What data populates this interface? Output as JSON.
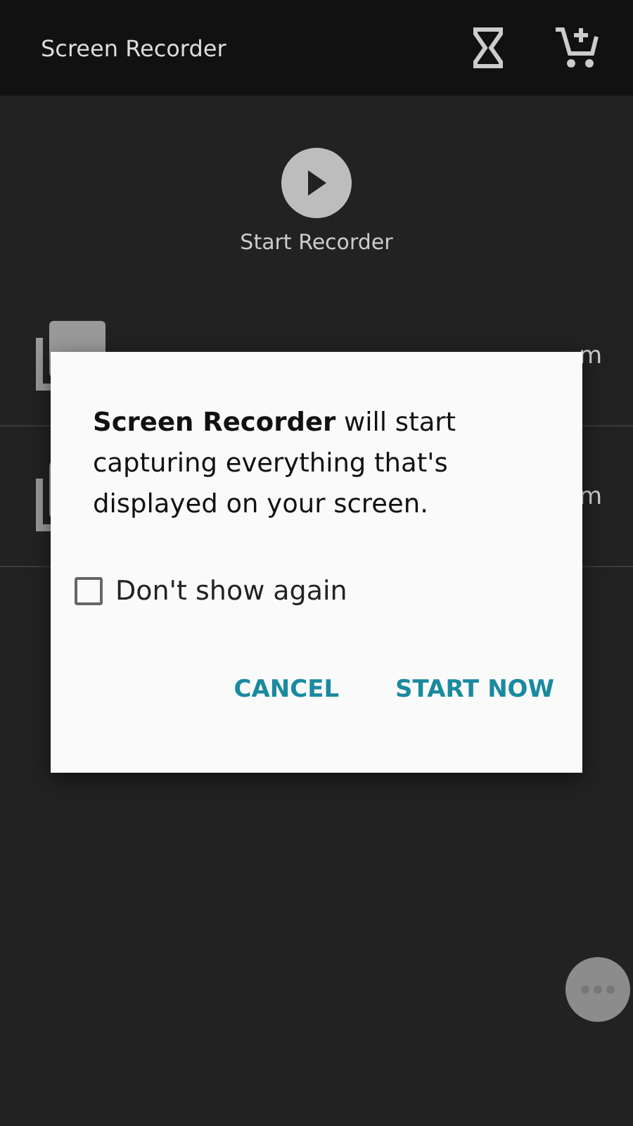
{
  "app_bar": {
    "title": "Screen Recorder"
  },
  "start": {
    "label": "Start Recorder"
  },
  "recordings": [
    {
      "name_tail": "m"
    },
    {
      "name_tail": "m"
    }
  ],
  "dialog": {
    "message": "**Screen Recorder** will start capturing everything that's displayed on your screen.",
    "checkbox": {
      "label": "Don't show again",
      "checked": false
    },
    "buttons": [
      "CANCEL",
      "START NOW"
    ]
  }
}
